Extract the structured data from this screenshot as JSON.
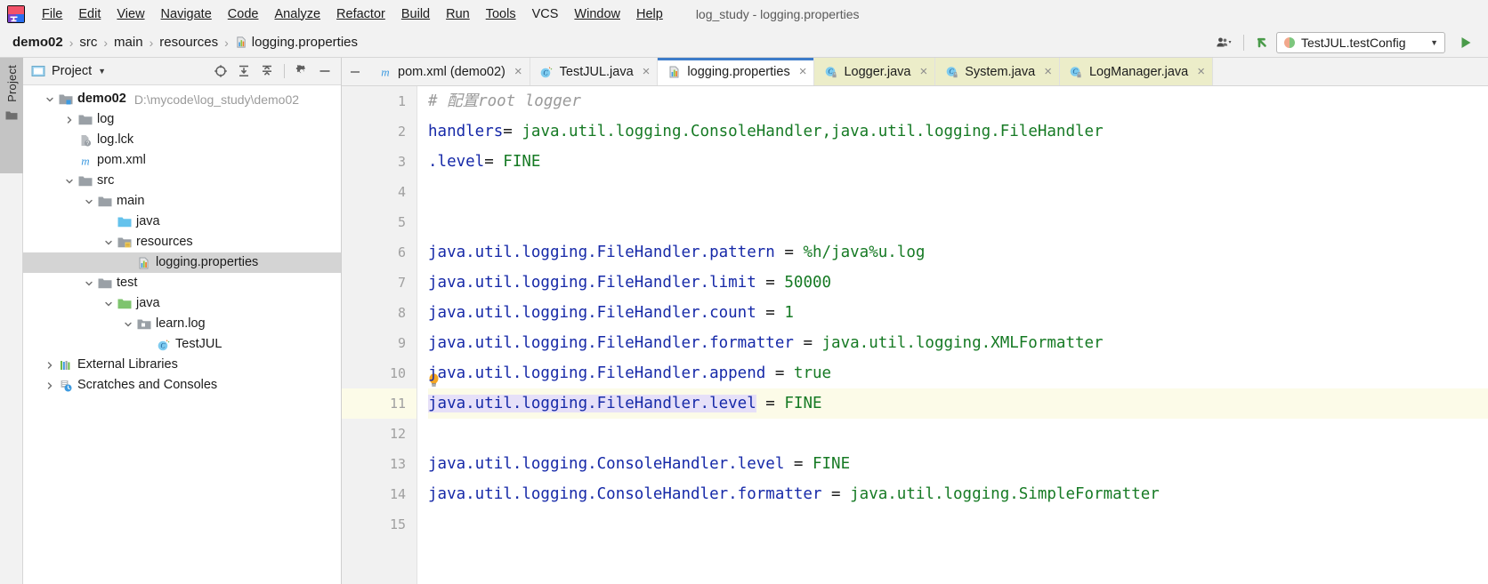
{
  "window": {
    "title": "log_study - logging.properties"
  },
  "menubar": {
    "logo_icon": "intellij-idea-logo",
    "items": [
      {
        "label": "File",
        "mnemonic": "F"
      },
      {
        "label": "Edit",
        "mnemonic": "E"
      },
      {
        "label": "View",
        "mnemonic": "V"
      },
      {
        "label": "Navigate",
        "mnemonic": "N"
      },
      {
        "label": "Code",
        "mnemonic": "C"
      },
      {
        "label": "Analyze",
        "mnemonic": "z"
      },
      {
        "label": "Refactor",
        "mnemonic": "R"
      },
      {
        "label": "Build",
        "mnemonic": "B"
      },
      {
        "label": "Run",
        "mnemonic": "u"
      },
      {
        "label": "Tools",
        "mnemonic": "T"
      },
      {
        "label": "VCS",
        "mnemonic": ""
      },
      {
        "label": "Window",
        "mnemonic": "W"
      },
      {
        "label": "Help",
        "mnemonic": "H"
      }
    ]
  },
  "navbar": {
    "breadcrumbs": [
      {
        "label": "demo02",
        "bold": true,
        "icon": ""
      },
      {
        "label": "src",
        "bold": false,
        "icon": ""
      },
      {
        "label": "main",
        "bold": false,
        "icon": ""
      },
      {
        "label": "resources",
        "bold": false,
        "icon": ""
      },
      {
        "label": "logging.properties",
        "bold": false,
        "icon": "properties-file-icon"
      }
    ],
    "separator": "›",
    "settings_sync_icon": "user-dropdown-icon",
    "update_icon": "vcs-update-icon",
    "run_config": {
      "label": "TestJUL.testConfig",
      "icon": "junit-run-config-icon",
      "caret": "▼"
    },
    "run_button_icon": "run-play-icon"
  },
  "tool_stripe": {
    "project_label": "Project",
    "project_icon": "folder-icon"
  },
  "project_panel": {
    "header": {
      "view_icon": "project-view-icon",
      "title": "Project",
      "caret": "▼",
      "tools": [
        {
          "name": "scroll-from-source-icon",
          "title": "Select Opened File"
        },
        {
          "name": "expand-all-icon",
          "title": "Expand All"
        },
        {
          "name": "collapse-all-icon",
          "title": "Collapse All"
        },
        {
          "name": "gear-icon",
          "title": "Settings"
        },
        {
          "name": "hide-icon",
          "title": "Hide"
        }
      ]
    },
    "tree": [
      {
        "label": "demo02",
        "path": "D:\\mycode\\log_study\\demo02",
        "indent": 0,
        "arrow": "expanded",
        "icon": "module-folder-icon",
        "bold": true,
        "selected": false
      },
      {
        "label": "log",
        "path": "",
        "indent": 1,
        "arrow": "collapsed",
        "icon": "folder-icon",
        "bold": false,
        "selected": false
      },
      {
        "label": "log.lck",
        "path": "",
        "indent": 1,
        "arrow": "none",
        "icon": "unknown-file-icon",
        "bold": false,
        "selected": false
      },
      {
        "label": "pom.xml",
        "path": "",
        "indent": 1,
        "arrow": "none",
        "icon": "maven-file-icon",
        "bold": false,
        "selected": false
      },
      {
        "label": "src",
        "path": "",
        "indent": 1,
        "arrow": "expanded",
        "icon": "folder-icon",
        "bold": false,
        "selected": false
      },
      {
        "label": "main",
        "path": "",
        "indent": 2,
        "arrow": "expanded",
        "icon": "folder-icon",
        "bold": false,
        "selected": false
      },
      {
        "label": "java",
        "path": "",
        "indent": 3,
        "arrow": "none",
        "icon": "source-root-icon",
        "bold": false,
        "selected": false
      },
      {
        "label": "resources",
        "path": "",
        "indent": 3,
        "arrow": "expanded",
        "icon": "resource-root-icon",
        "bold": false,
        "selected": false
      },
      {
        "label": "logging.properties",
        "path": "",
        "indent": 4,
        "arrow": "none",
        "icon": "properties-file-icon",
        "bold": false,
        "selected": true
      },
      {
        "label": "test",
        "path": "",
        "indent": 2,
        "arrow": "expanded",
        "icon": "folder-icon",
        "bold": false,
        "selected": false
      },
      {
        "label": "java",
        "path": "",
        "indent": 3,
        "arrow": "expanded",
        "icon": "test-source-root-icon",
        "bold": false,
        "selected": false
      },
      {
        "label": "learn.log",
        "path": "",
        "indent": 4,
        "arrow": "expanded",
        "icon": "package-icon",
        "bold": false,
        "selected": false
      },
      {
        "label": "TestJUL",
        "path": "",
        "indent": 5,
        "arrow": "none",
        "icon": "java-test-class-icon",
        "bold": false,
        "selected": false
      },
      {
        "label": "External Libraries",
        "path": "",
        "indent": 0,
        "arrow": "collapsed",
        "icon": "libraries-icon",
        "bold": false,
        "selected": false
      },
      {
        "label": "Scratches and Consoles",
        "path": "",
        "indent": 0,
        "arrow": "collapsed",
        "icon": "scratches-icon",
        "bold": false,
        "selected": false
      }
    ]
  },
  "editor": {
    "hide_tabs_icon": "hide-panel-icon",
    "tabs": [
      {
        "label": "pom.xml (demo02)",
        "icon": "maven-file-icon",
        "active": false,
        "library": false,
        "close": "×"
      },
      {
        "label": "TestJUL.java",
        "icon": "java-test-class-icon",
        "active": false,
        "library": false,
        "close": "×"
      },
      {
        "label": "logging.properties",
        "icon": "properties-file-icon",
        "active": true,
        "library": false,
        "close": "×"
      },
      {
        "label": "Logger.java",
        "icon": "java-class-readonly-icon",
        "active": false,
        "library": true,
        "close": "×"
      },
      {
        "label": "System.java",
        "icon": "java-class-readonly-icon",
        "active": false,
        "library": true,
        "close": "×"
      },
      {
        "label": "LogManager.java",
        "icon": "java-class-readonly-icon",
        "active": false,
        "library": true,
        "close": "×"
      }
    ],
    "gutter": {
      "line_numbers": [
        "1",
        "2",
        "3",
        "4",
        "5",
        "6",
        "7",
        "8",
        "9",
        "10",
        "11",
        "12",
        "13",
        "14",
        "15"
      ],
      "current_line": "11",
      "intention_bulb_icon": "lightbulb-icon",
      "intention_bulb_line": "11"
    },
    "lines": [
      {
        "n": "1",
        "comment": "# 配置root logger",
        "key": "",
        "eq": "",
        "value": "",
        "selected_key": false,
        "current": false
      },
      {
        "n": "2",
        "comment": "",
        "key": "handlers",
        "eq": "= ",
        "value": "java.util.logging.ConsoleHandler,java.util.logging.FileHandler",
        "selected_key": false,
        "current": false
      },
      {
        "n": "3",
        "comment": "",
        "key": ".level",
        "eq": "= ",
        "value": "FINE",
        "selected_key": false,
        "current": false
      },
      {
        "n": "4",
        "comment": "",
        "key": "",
        "eq": "",
        "value": "",
        "selected_key": false,
        "current": false
      },
      {
        "n": "5",
        "comment": "",
        "key": "",
        "eq": "",
        "value": "",
        "selected_key": false,
        "current": false
      },
      {
        "n": "6",
        "comment": "",
        "key": "java.util.logging.FileHandler.pattern",
        "eq": " = ",
        "value": "%h/java%u.log",
        "selected_key": false,
        "current": false
      },
      {
        "n": "7",
        "comment": "",
        "key": "java.util.logging.FileHandler.limit",
        "eq": " = ",
        "value": "50000",
        "selected_key": false,
        "current": false
      },
      {
        "n": "8",
        "comment": "",
        "key": "java.util.logging.FileHandler.count",
        "eq": " = ",
        "value": "1",
        "selected_key": false,
        "current": false
      },
      {
        "n": "9",
        "comment": "",
        "key": "java.util.logging.FileHandler.formatter",
        "eq": " = ",
        "value": "java.util.logging.XMLFormatter",
        "selected_key": false,
        "current": false
      },
      {
        "n": "10",
        "comment": "",
        "key": "java.util.logging.FileHandler.append",
        "eq": " = ",
        "value": "true",
        "selected_key": false,
        "current": false
      },
      {
        "n": "11",
        "comment": "",
        "key": "java.util.logging.FileHandler.level",
        "eq": " = ",
        "value": "FINE",
        "selected_key": true,
        "current": true
      },
      {
        "n": "12",
        "comment": "",
        "key": "",
        "eq": "",
        "value": "",
        "selected_key": false,
        "current": false
      },
      {
        "n": "13",
        "comment": "",
        "key": "java.util.logging.ConsoleHandler.level",
        "eq": " = ",
        "value": "FINE",
        "selected_key": false,
        "current": false
      },
      {
        "n": "14",
        "comment": "",
        "key": "java.util.logging.ConsoleHandler.formatter",
        "eq": " = ",
        "value": "java.util.logging.SimpleFormatter",
        "selected_key": false,
        "current": false
      },
      {
        "n": "15",
        "comment": "",
        "key": "",
        "eq": "",
        "value": "",
        "selected_key": false,
        "current": false
      }
    ]
  },
  "colors": {
    "key": "#1629a8",
    "value": "#167a24",
    "comment": "#9a9a9a",
    "current_line_bg": "#fcfbe8",
    "selection_bg": "#e6e0f8",
    "active_tab_underline": "#3d7cc9",
    "library_tab_bg": "#ecedc9",
    "tree_selection_bg": "#d4d4d4",
    "run_green": "#4a9b4a"
  }
}
